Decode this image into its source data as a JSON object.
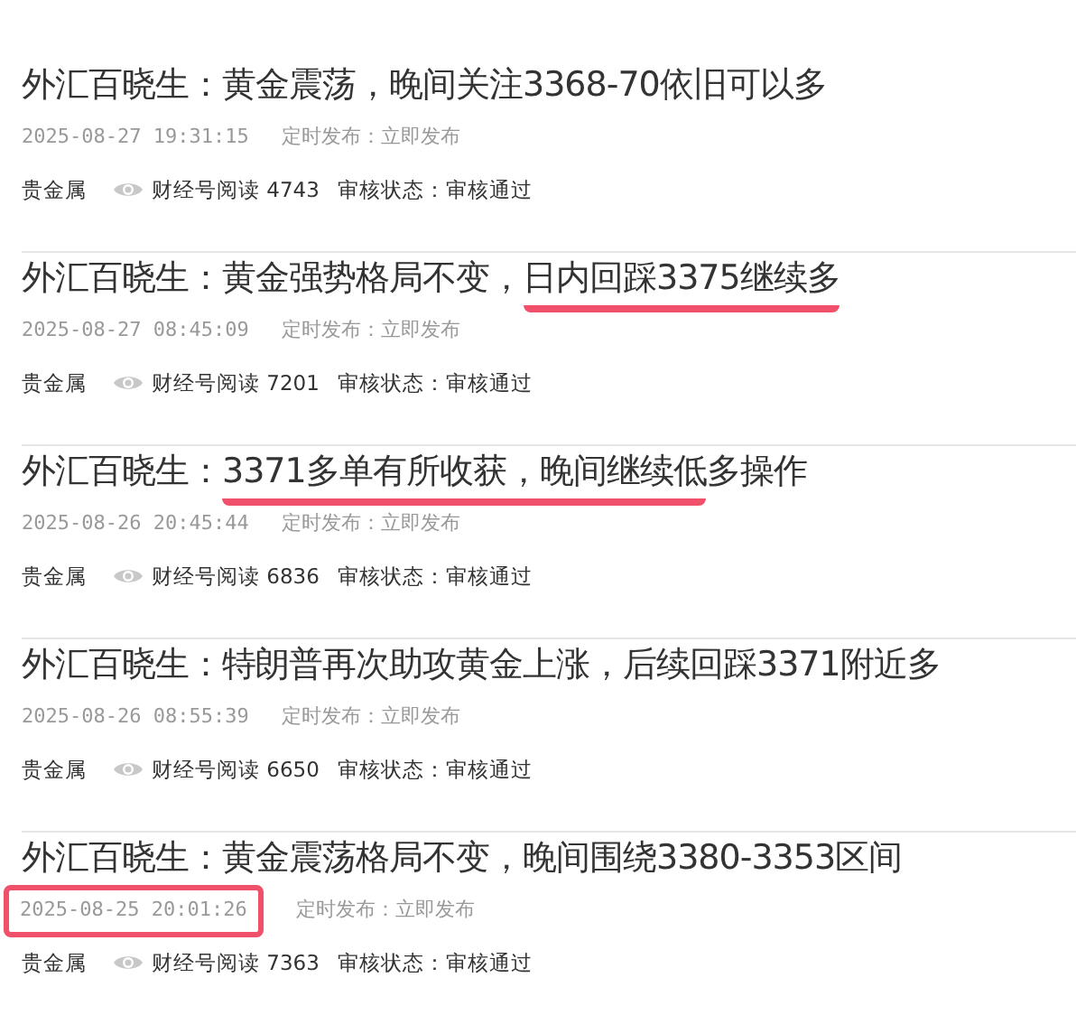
{
  "articles": [
    {
      "title": [
        {
          "text": "外汇百晓生：黄金震荡，晚间关注3368-70依旧可以多",
          "underlined": false
        }
      ],
      "date": "2025-08-27 19:31:15",
      "date_boxed": false,
      "publish": "定时发布：立即发布",
      "category": "贵金属",
      "reads": "财经号阅读 4743",
      "review": "审核状态：审核通过"
    },
    {
      "title": [
        {
          "text": "外汇百晓生：黄金强势格局不变，",
          "underlined": false
        },
        {
          "text": "日内回踩3375继续多",
          "underlined": true
        }
      ],
      "date": "2025-08-27 08:45:09",
      "date_boxed": false,
      "publish": "定时发布：立即发布",
      "category": "贵金属",
      "reads": "财经号阅读 7201",
      "review": "审核状态：审核通过"
    },
    {
      "title": [
        {
          "text": "外汇百晓生：",
          "underlined": false
        },
        {
          "text": "3371多单有所收获，晚间继续低",
          "underlined": true
        },
        {
          "text": "多操作",
          "underlined": false
        }
      ],
      "date": "2025-08-26 20:45:44",
      "date_boxed": false,
      "publish": "定时发布：立即发布",
      "category": "贵金属",
      "reads": "财经号阅读 6836",
      "review": "审核状态：审核通过"
    },
    {
      "title": [
        {
          "text": "外汇百晓生：特朗普再次助攻黄金上涨，后续回踩3371附近多",
          "underlined": false
        }
      ],
      "date": "2025-08-26 08:55:39",
      "date_boxed": false,
      "publish": "定时发布：立即发布",
      "category": "贵金属",
      "reads": "财经号阅读 6650",
      "review": "审核状态：审核通过"
    },
    {
      "title": [
        {
          "text": "外汇百晓生：黄金震荡格局不变，晚间围绕3380-3353区间",
          "underlined": false
        }
      ],
      "date": "2025-08-25 20:01:26",
      "date_boxed": true,
      "publish": "定时发布：立即发布",
      "category": "贵金属",
      "reads": "财经号阅读 7363",
      "review": "审核状态：审核通过"
    }
  ]
}
